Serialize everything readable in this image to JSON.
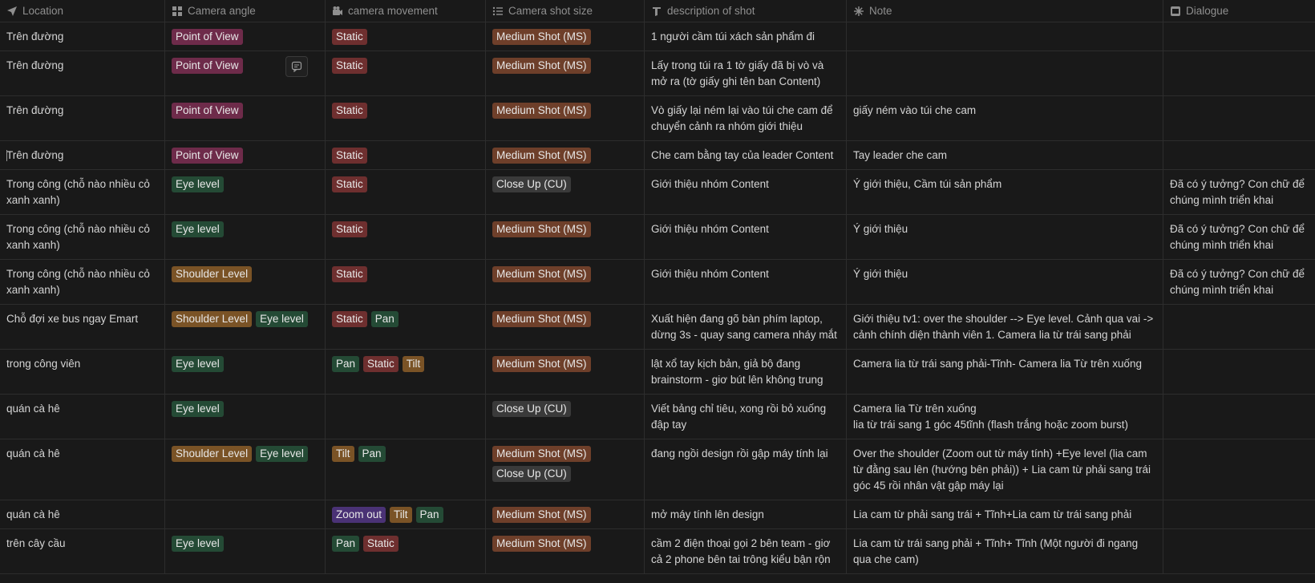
{
  "headers": [
    {
      "label": "Location",
      "icon": "location-arrow-icon"
    },
    {
      "label": "Camera angle",
      "icon": "grid-icon"
    },
    {
      "label": "camera movement",
      "icon": "camera-icon"
    },
    {
      "label": "Camera shot size",
      "icon": "list-icon"
    },
    {
      "label": "description of shot",
      "icon": "text-icon"
    },
    {
      "label": "Note",
      "icon": "sparkle-icon"
    },
    {
      "label": "Dialogue",
      "icon": "film-icon"
    }
  ],
  "tag_colors": {
    "Point of View": "#6e2b4a",
    "Eye level": "#244a35",
    "Shoulder Level": "#7a5326",
    "Static": "#6e2f2f",
    "Pan": "#244a35",
    "Tilt": "#7a5326",
    "Zoom out": "#4a3275",
    "Medium Shot (MS)": "#6e3f2a",
    "Close Up (CU)": "#3a3a3a"
  },
  "rows": [
    {
      "location": "Trên đường",
      "angle": [
        "Point of View"
      ],
      "movement": [
        "Static"
      ],
      "shot": [
        "Medium Shot (MS)"
      ],
      "description": "1 người cầm túi xách sản phẩm đi",
      "note": "",
      "dialogue": ""
    },
    {
      "location": "Trên đường",
      "angle": [
        "Point of View"
      ],
      "movement": [
        "Static"
      ],
      "shot": [
        "Medium Shot (MS)"
      ],
      "description": "Lấy trong túi ra 1 tờ giấy đã bị vò và mở ra (tờ giấy ghi tên ban Content)",
      "note": "",
      "dialogue": ""
    },
    {
      "location": "Trên đường",
      "angle": [
        "Point of View"
      ],
      "movement": [
        "Static"
      ],
      "shot": [
        "Medium Shot (MS)"
      ],
      "description": "Vò giấy lại ném lại vào túi che cam để chuyển cảnh ra nhóm giới thiệu",
      "note": "giấy ném vào túi che cam",
      "dialogue": ""
    },
    {
      "location": "Trên đường",
      "angle": [
        "Point of View"
      ],
      "movement": [
        "Static"
      ],
      "shot": [
        "Medium Shot (MS)"
      ],
      "description": "Che cam bằng tay của leader Content",
      "note": "Tay leader che cam",
      "dialogue": ""
    },
    {
      "location": "Trong công (chỗ nào nhiều cỏ xanh xanh)",
      "angle": [
        "Eye level"
      ],
      "movement": [
        "Static"
      ],
      "shot": [
        "Close Up (CU)"
      ],
      "description": "Giới thiệu nhóm Content",
      "note": "Ý giới thiệu, Cầm túi sản phẩm",
      "dialogue": "Đã có ý tưởng? Con chữ để chúng mình triển khai"
    },
    {
      "location": "Trong công (chỗ nào nhiều cỏ xanh xanh)",
      "angle": [
        "Eye level"
      ],
      "movement": [
        "Static"
      ],
      "shot": [
        "Medium Shot (MS)"
      ],
      "description": "Giới thiệu nhóm Content",
      "note": "Ý giới thiệu",
      "dialogue": "Đã có ý tưởng? Con chữ để chúng mình triển khai"
    },
    {
      "location": "Trong công (chỗ nào nhiều cỏ xanh xanh)",
      "angle": [
        "Shoulder Level"
      ],
      "movement": [
        "Static"
      ],
      "shot": [
        "Medium Shot (MS)"
      ],
      "description": "Giới thiệu nhóm Content",
      "note": "Ý giới thiệu",
      "dialogue": "Đã có ý tưởng? Con chữ để chúng mình triển khai"
    },
    {
      "location": "Chỗ đợi xe bus ngay Emart",
      "angle": [
        "Shoulder Level",
        "Eye level"
      ],
      "movement": [
        "Static",
        "Pan"
      ],
      "shot": [
        "Medium Shot (MS)"
      ],
      "description": "Xuất hiện đang gõ bàn phím laptop, dừng 3s - quay sang camera nháy mắt",
      "note": "Giới thiệu tv1: over the shoulder --> Eye level. Cảnh qua vai -> cảnh chính diện thành viên 1. Camera lia từ trái sang phải",
      "dialogue": ""
    },
    {
      "location": "trong công viên",
      "angle": [
        "Eye level"
      ],
      "movement": [
        "Pan",
        "Static",
        "Tilt"
      ],
      "shot": [
        "Medium Shot (MS)"
      ],
      "description": " lật xổ tay kịch bản, giả bộ đang brainstorm - giơ bút lên không trung",
      "note": "Camera lia từ trái sang phải-Tĩnh- Camera lia Từ trên xuống",
      "dialogue": ""
    },
    {
      "location": "quán cà hê",
      "angle": [
        "Eye level"
      ],
      "movement": [],
      "shot": [
        "Close Up (CU)"
      ],
      "description": "Viết bảng chỉ tiêu, xong rồi bỏ xuống đập tay",
      "note": "Camera lia Từ trên xuống\nlia từ trái sang 1 góc 45tĩnh (flash trắng hoặc zoom burst)",
      "dialogue": ""
    },
    {
      "location": "quán cà hê",
      "angle": [
        "Shoulder Level",
        "Eye level"
      ],
      "movement": [
        "Tilt",
        "Pan"
      ],
      "shot": [
        "Medium Shot (MS)",
        "Close Up (CU)"
      ],
      "description": "đang ngồi design rồi gập máy tính lại",
      "note": "Over the shoulder (Zoom out từ máy tính) +Eye level (lia cam từ đằng sau lên (hướng bên phải)) + Lia cam từ phải sang trái góc 45 rồi nhân vật gập máy lại",
      "dialogue": ""
    },
    {
      "location": "quán cà hê",
      "angle": [],
      "movement": [
        "Zoom out",
        "Tilt",
        "Pan"
      ],
      "shot": [
        "Medium Shot (MS)"
      ],
      "description": "mở máy tính lên design",
      "note": "Lia cam từ phải sang trái + Tĩnh+Lia cam từ trái sang phải",
      "dialogue": ""
    },
    {
      "location": "trên cây cầu",
      "angle": [
        "Eye level"
      ],
      "movement": [
        "Pan",
        "Static"
      ],
      "shot": [
        "Medium Shot (MS)"
      ],
      "description": "cầm 2 điện thoại gọi 2 bên team - giơ cả 2 phone bên tai trông kiểu bận rộn",
      "note": "Lia cam từ trái sang phải + Tĩnh+ Tĩnh (Một người đi ngang qua che cam)",
      "dialogue": ""
    }
  ]
}
